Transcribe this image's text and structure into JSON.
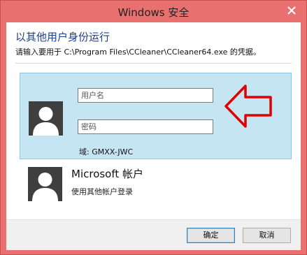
{
  "window": {
    "title": "Windows 安全"
  },
  "dialog": {
    "heading": "以其他用户身份运行",
    "subtitle": "请输入要用于 C:\\Program Files\\CCleaner\\CCleaner64.exe 的凭据。"
  },
  "credential": {
    "username_placeholder": "用户名",
    "password_placeholder": "密码",
    "domain_label": "域: GMXX-JWC"
  },
  "microsoft_account": {
    "title": "Microsoft 帐户",
    "subtitle": "使用其他帐户登录"
  },
  "buttons": {
    "ok": "确定",
    "cancel": "取消"
  },
  "colors": {
    "titlebar": "#e8706e",
    "heading": "#1e3f8a",
    "panel_bg": "#c5e5f3",
    "annotation": "#e00000"
  },
  "icons": {
    "close": "close-icon",
    "user_avatar": "user-avatar-icon",
    "annotation_arrow": "red-arrow-annotation"
  }
}
